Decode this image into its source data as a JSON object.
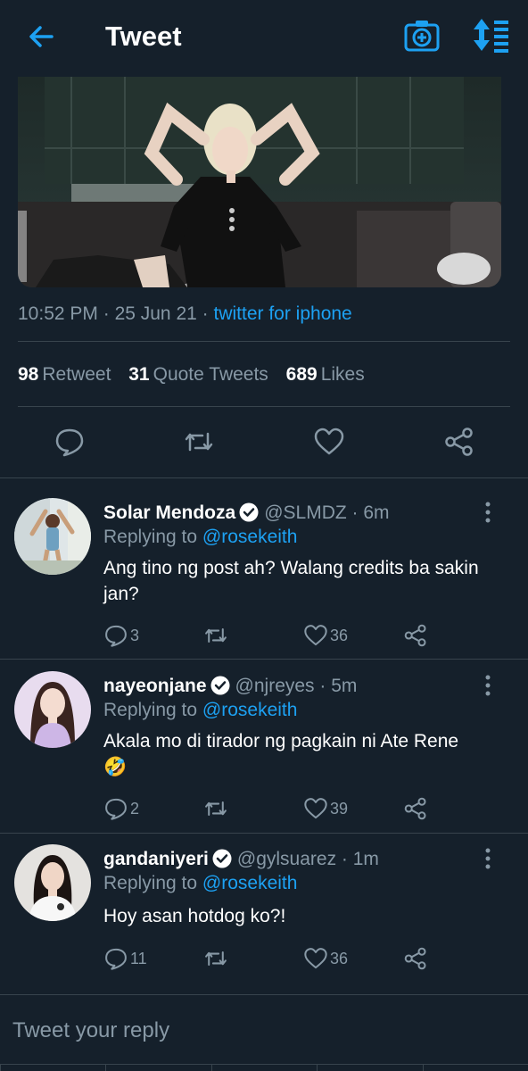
{
  "header": {
    "title": "Tweet"
  },
  "tweet": {
    "time": "10:52 PM",
    "separator1": " · ",
    "date": "25 Jun 21",
    "separator2": " · ",
    "source": "twitter for iphone",
    "stats": {
      "retweets_count": "98",
      "retweets_label": "Retweet",
      "quotes_count": "31",
      "quotes_label": "Quote Tweets",
      "likes_count": "689",
      "likes_label": "Likes"
    }
  },
  "replies": [
    {
      "name": "Solar Mendoza",
      "handle_time": "@SLMDZ · 6m",
      "replying_prefix": "Replying to ",
      "replying_user": "@rosekeith",
      "text": "Ang tino ng post ah? Walang credits ba sakin jan?",
      "reply_count": "3",
      "retweet_count": "",
      "like_count": "36"
    },
    {
      "name": "nayeonjane",
      "handle_time": "@njreyes · 5m",
      "replying_prefix": "Replying to ",
      "replying_user": "@rosekeith",
      "text": "Akala mo di tirador ng pagkain ni Ate Rene",
      "emoji": "🤣",
      "reply_count": "2",
      "retweet_count": "",
      "like_count": "39"
    },
    {
      "name": "gandaniyeri",
      "handle_time": "@gylsuarez · 1m",
      "replying_prefix": "Replying to ",
      "replying_user": "@rosekeith",
      "text": "Hoy asan hotdog ko?!",
      "reply_count": "11",
      "retweet_count": "",
      "like_count": "36"
    }
  ],
  "composer": {
    "placeholder": "Tweet your reply"
  },
  "colors": {
    "background": "#15202b",
    "accent": "#1da1f2",
    "muted": "#8899a6",
    "divider": "#38444d"
  },
  "icons": {
    "back": "arrow-left-icon",
    "camera": "camera-plus-icon",
    "sort": "sort-icon",
    "reply": "comment-icon",
    "retweet": "retweet-icon",
    "like": "heart-icon",
    "share": "share-icon",
    "verified": "verified-badge-icon",
    "more": "more-vertical-icon"
  }
}
